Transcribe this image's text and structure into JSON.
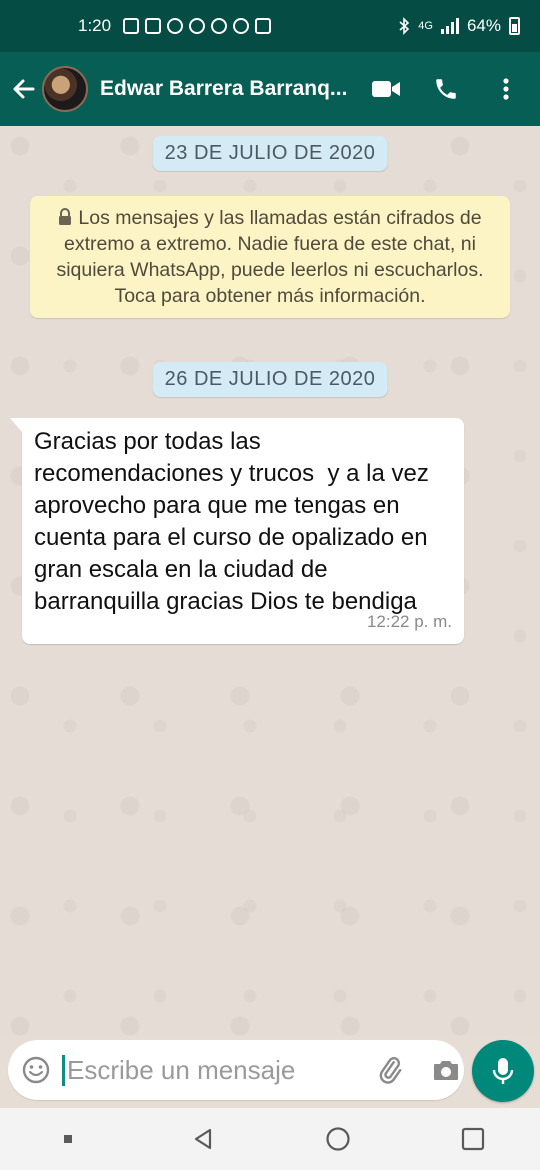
{
  "status_bar": {
    "time": "1:20",
    "battery": "64%",
    "network": "4G"
  },
  "header": {
    "contact_name": "Edwar Barrera Barranq..."
  },
  "chat": {
    "date_1": "23 DE JULIO DE 2020",
    "encryption_notice": "Los mensajes y las llamadas están cifrados de extremo a extremo. Nadie fuera de este chat, ni siquiera WhatsApp, puede leerlos ni escucharlos. Toca para obtener más información.",
    "date_2": "26 DE JULIO DE 2020",
    "messages": [
      {
        "text": "Gracias por todas las recomendaciones y trucos  y a la vez aprovecho para que me tengas en cuenta para el curso de opalizado en gran escala en la ciudad de barranquilla gracias Dios te bendiga",
        "time": "12:22 p. m."
      }
    ]
  },
  "composer": {
    "placeholder": "Escribe un mensaje"
  },
  "colors": {
    "header": "#075e54",
    "status_bar": "#054d44",
    "accent": "#00897b",
    "chat_bg": "#e5ddd5",
    "notice_bg": "#fdf4c5",
    "date_chip_bg": "#d4eaf4"
  },
  "icons": {
    "back": "arrow-left-icon",
    "video": "video-camera-icon",
    "call": "phone-icon",
    "menu": "more-vert-icon",
    "emoji": "emoji-icon",
    "attach": "paperclip-icon",
    "camera": "camera-icon",
    "mic": "mic-icon"
  }
}
